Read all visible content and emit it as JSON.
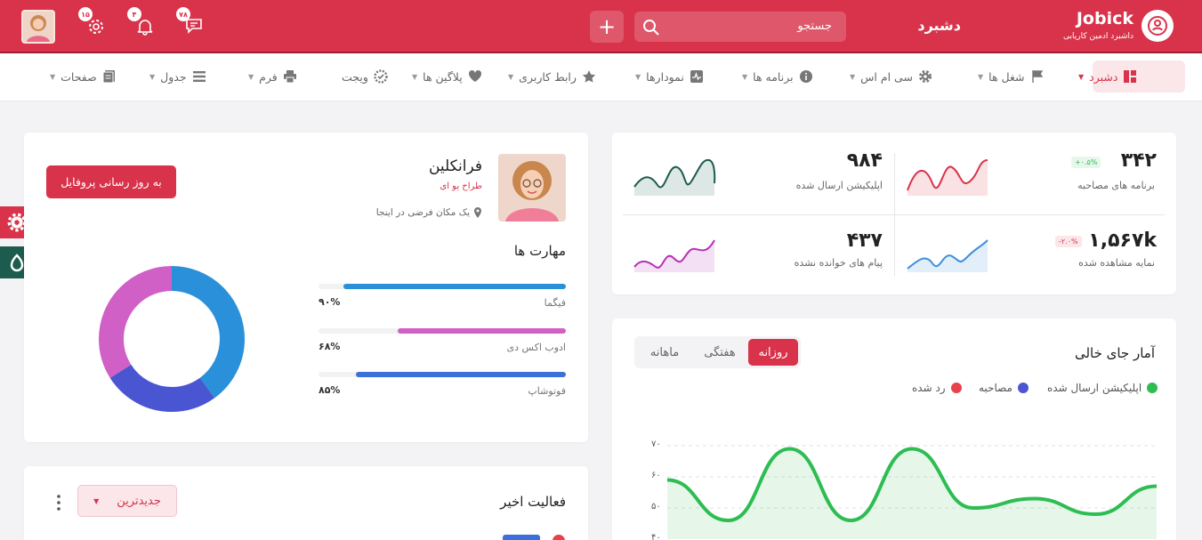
{
  "header": {
    "brand": "Jobick",
    "brand_sub": "داشبرد ادمین کاریابی",
    "page_title": "دشبرد",
    "search_placeholder": "جستجو",
    "plus_label": "+",
    "badges": {
      "messages": "۷۸",
      "notifications": "۴",
      "settings": "۱۵"
    },
    "colors": {
      "primary": "#d8334a",
      "dark_green": "#1c5b4e"
    }
  },
  "nav": {
    "items": [
      {
        "label": "دشبرد",
        "icon": "grid-icon"
      },
      {
        "label": "شغل ها",
        "icon": "flag-icon"
      },
      {
        "label": "سی ام اس",
        "icon": "gear-icon"
      },
      {
        "label": "برنامه ها",
        "icon": "info-icon"
      },
      {
        "label": "نمودارها",
        "icon": "activity-icon"
      },
      {
        "label": "رابط کاربری",
        "icon": "star-icon"
      },
      {
        "label": "پلاگین ها",
        "icon": "heart-icon"
      },
      {
        "label": "ویجت",
        "icon": "badge-icon"
      },
      {
        "label": "فرم",
        "icon": "printer-icon"
      },
      {
        "label": "جدول",
        "icon": "table-icon"
      },
      {
        "label": "صفحات",
        "icon": "pages-icon"
      }
    ]
  },
  "stats": {
    "interviews": {
      "value": "۳۴۲",
      "label": "برنامه های مصاحبه",
      "change": "+۰.۵%",
      "color": "#d8334a"
    },
    "applications": {
      "value": "۹۸۴",
      "label": "اپلیکیشن ارسال شده",
      "color": "#1c5b4e"
    },
    "profile_views": {
      "value": "۱,۵۶۷k",
      "label": "نمایه مشاهده شده",
      "change": "-۲.۰%",
      "color": "#3f8fdc"
    },
    "unread_messages": {
      "value": "۴۳۷",
      "label": "پیام های خوانده نشده",
      "color": "#b82fb5"
    }
  },
  "profile": {
    "name": "فرانکلین",
    "role": "طراح یو ای",
    "location": "یک مکان فرضی در اینجا",
    "update_button": "به روز رسانی پروفایل",
    "skills_title": "مهارت ها",
    "skills": [
      {
        "name": "فیگما",
        "value": 90,
        "label": "۹۰%",
        "color": "#2a90d9"
      },
      {
        "name": "ادوب اکس دی",
        "value": 68,
        "label": "۶۸%",
        "color": "#d160c6"
      },
      {
        "name": "فوتوشاپ",
        "value": 85,
        "label": "۸۵%",
        "color": "#3d6fdb"
      }
    ],
    "donut": [
      {
        "value": 40,
        "color": "#2a90d9"
      },
      {
        "value": 26,
        "color": "#4a55d1"
      },
      {
        "value": 34,
        "color": "#d160c6"
      }
    ]
  },
  "vacancy": {
    "title": "آمار جای خالی",
    "tabs": [
      "روزانه",
      "هفتگی",
      "ماهانه"
    ],
    "active_tab": "روزانه",
    "legend": [
      {
        "label": "اپلیکیشن ارسال شده",
        "color": "#2ebd52"
      },
      {
        "label": "مصاحبه",
        "color": "#4a55d1"
      },
      {
        "label": "رد شده",
        "color": "#e8414b"
      }
    ]
  },
  "activity": {
    "title": "فعالیت اخیر",
    "dropdown": "جدیدترین"
  },
  "chart_data": {
    "type": "area",
    "series": [
      {
        "name": "اپلیکیشن ارسال شده",
        "values": [
          59,
          46,
          69,
          46,
          69,
          50,
          53,
          48,
          57
        ]
      }
    ],
    "ylim": [
      40,
      70
    ],
    "yticks": [
      "۷۰",
      "۶۰",
      "۵۰",
      "۴۰"
    ],
    "grid": true
  }
}
